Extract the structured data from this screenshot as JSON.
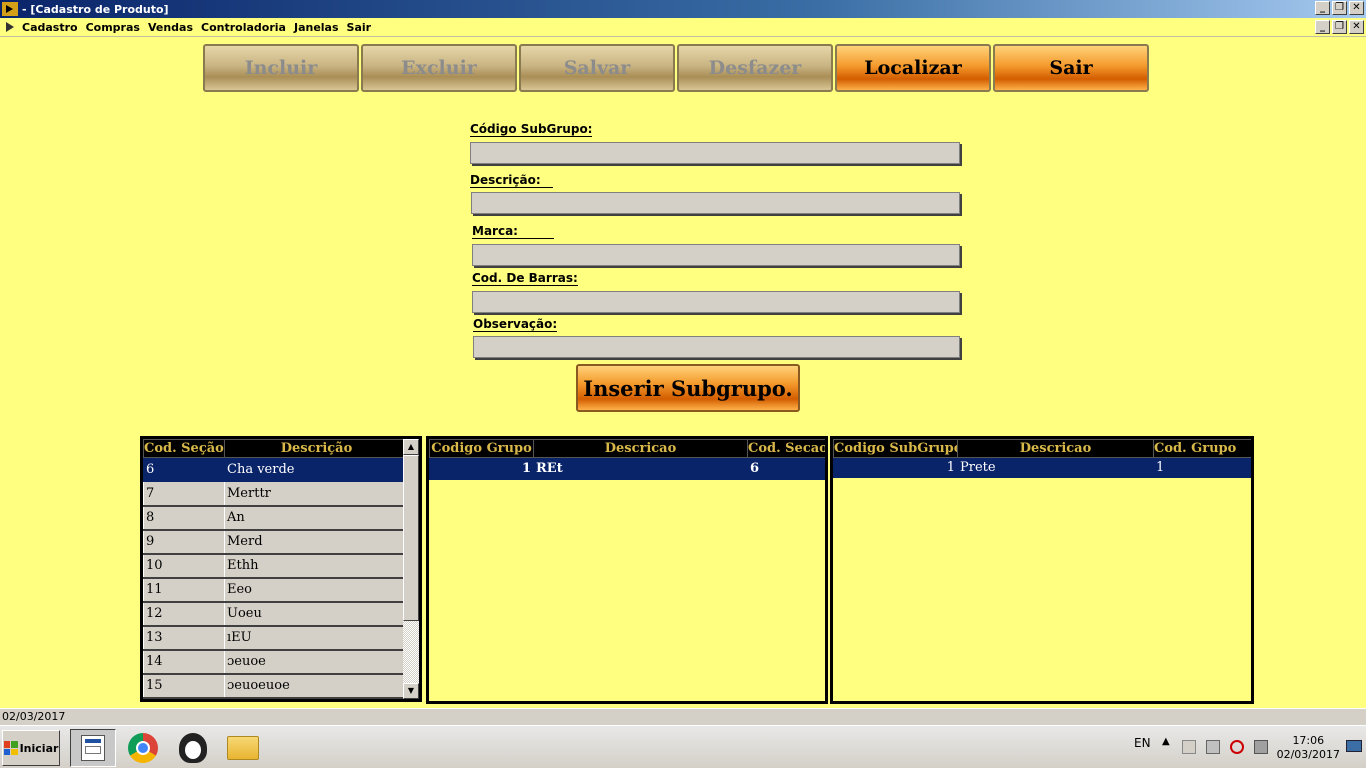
{
  "window": {
    "title": "- [Cadastro de Produto]",
    "controls": [
      "_",
      "❐",
      "✕"
    ]
  },
  "menu": {
    "items": [
      "Cadastro",
      "Compras",
      "Vendas",
      "Controladoria",
      "Janelas",
      "Sair"
    ]
  },
  "toolbar": {
    "incluir": "Incluir",
    "excluir": "Excluir",
    "salvar": "Salvar",
    "desfazer": "Desfazer",
    "localizar": "Localizar",
    "sair": "Sair"
  },
  "form": {
    "codigo_subgrupo_label": "Código SubGrupo:",
    "codigo_subgrupo_value": "",
    "descricao_label": "Descrição:",
    "descricao_value": "",
    "marca_label": "Marca:",
    "marca_value": "",
    "cod_barras_label": "Cod. De Barras:",
    "cod_barras_value": "",
    "observacao_label": "Observação:",
    "observacao_value": "",
    "inserir_label": "Inserir Subgrupo."
  },
  "secoes_grid": {
    "headers": [
      "Cod. Seção",
      "Descrição"
    ],
    "rows": [
      [
        "6",
        "Cha verde"
      ],
      [
        "7",
        "Merttr"
      ],
      [
        "8",
        "An"
      ],
      [
        "9",
        "Merd"
      ],
      [
        "10",
        "Ethh"
      ],
      [
        "11",
        "Eeo"
      ],
      [
        "12",
        "Uoeu"
      ],
      [
        "13",
        "ıEU"
      ],
      [
        "14",
        "ɔeuoe"
      ],
      [
        "15",
        "ɔeuoeuoe"
      ]
    ],
    "selected_index": 0
  },
  "grupos_grid": {
    "headers": [
      "Codigo Grupo",
      "Descricao",
      "Cod. Secao"
    ],
    "rows": [
      [
        "1",
        "REt",
        "6"
      ]
    ]
  },
  "subgrupos_grid": {
    "headers": [
      "Codigo SubGrupo",
      "Descricao",
      "Cod. Grupo"
    ],
    "rows": [
      [
        "1",
        "Prete",
        "1"
      ]
    ]
  },
  "status": {
    "date": "02/03/2017"
  },
  "taskbar": {
    "start_label": "Iniciar",
    "language": "EN",
    "time": "17:06",
    "date": "02/03/2017"
  },
  "colors": {
    "background": "#ffff80",
    "selection": "#0a246a",
    "header_bg": "#000000",
    "header_text": "#d9b84a",
    "active_button": "#f49a2c"
  }
}
